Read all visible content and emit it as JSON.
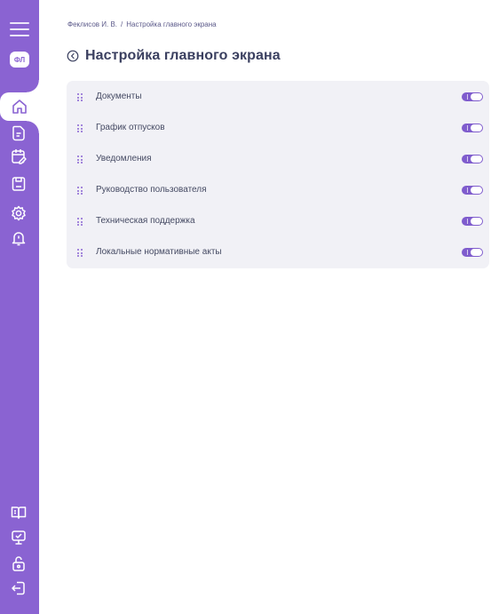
{
  "sidebar": {
    "avatar_initials": "ФЛ",
    "top_icons": [
      "menu-icon",
      "home-icon",
      "document-icon",
      "calendar-edit-icon",
      "save-icon",
      "gear-icon",
      "bell-icon"
    ],
    "bottom_icons": [
      "book-icon",
      "monitor-icon",
      "unlock-icon",
      "logout-icon"
    ]
  },
  "breadcrumb": {
    "user": "Феклисов И. В.",
    "separator": "/",
    "current": "Настройка главного экрана"
  },
  "page": {
    "title": "Настройка главного экрана"
  },
  "items": [
    {
      "label": "Документы",
      "enabled": true
    },
    {
      "label": "График отпусков",
      "enabled": true
    },
    {
      "label": "Уведомления",
      "enabled": true
    },
    {
      "label": "Руководство пользователя",
      "enabled": true
    },
    {
      "label": "Техническая поддержка",
      "enabled": true
    },
    {
      "label": "Локальные нормативные акты",
      "enabled": true
    }
  ],
  "colors": {
    "accent": "#8a63d2",
    "panel_bg": "#f1f1f6",
    "title": "#3b4060"
  }
}
